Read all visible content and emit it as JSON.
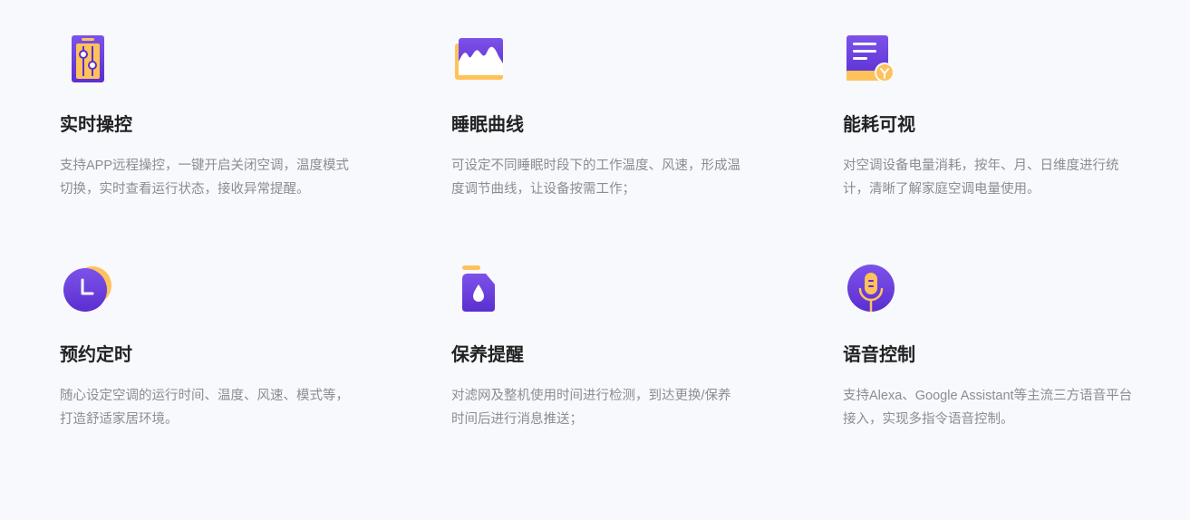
{
  "features": [
    {
      "icon": "slider-controls-icon",
      "title": "实时操控",
      "desc": [
        "支持APP远程操控，一键开启关闭空调，温度模式",
        "切换，实时查看运行状态，接收异常提醒。"
      ]
    },
    {
      "icon": "sleep-curve-icon",
      "title": "睡眠曲线",
      "desc": [
        "可设定不同睡眠时段下的工作温度、风速，形成温",
        "度调节曲线，让设备按需工作；"
      ]
    },
    {
      "icon": "energy-report-icon",
      "title": "能耗可视",
      "desc": [
        "对空调设备电量消耗，按年、月、日维度进行统",
        "计，清晰了解家庭空调电量使用。"
      ]
    },
    {
      "icon": "clock-icon",
      "title": "预约定时",
      "desc": [
        "随心设定空调的运行时间、温度、风速、模式等，",
        "打造舒适家居环境。"
      ]
    },
    {
      "icon": "filter-drop-icon",
      "title": "保养提醒",
      "desc": [
        "对滤网及整机使用时间进行检测，到达更换/保养",
        "时间后进行消息推送；"
      ]
    },
    {
      "icon": "microphone-icon",
      "title": "语音控制",
      "desc": [
        "支持Alexa、Google Assistant等主流三方语音平台",
        "接入，实现多指令语音控制。"
      ]
    }
  ],
  "colors": {
    "purple_dark": "#5a2fd0",
    "purple_light": "#7d52ea",
    "yellow": "#ffc25a",
    "title": "#222222",
    "desc": "#8a8d94",
    "background": "#f7f9fd"
  }
}
